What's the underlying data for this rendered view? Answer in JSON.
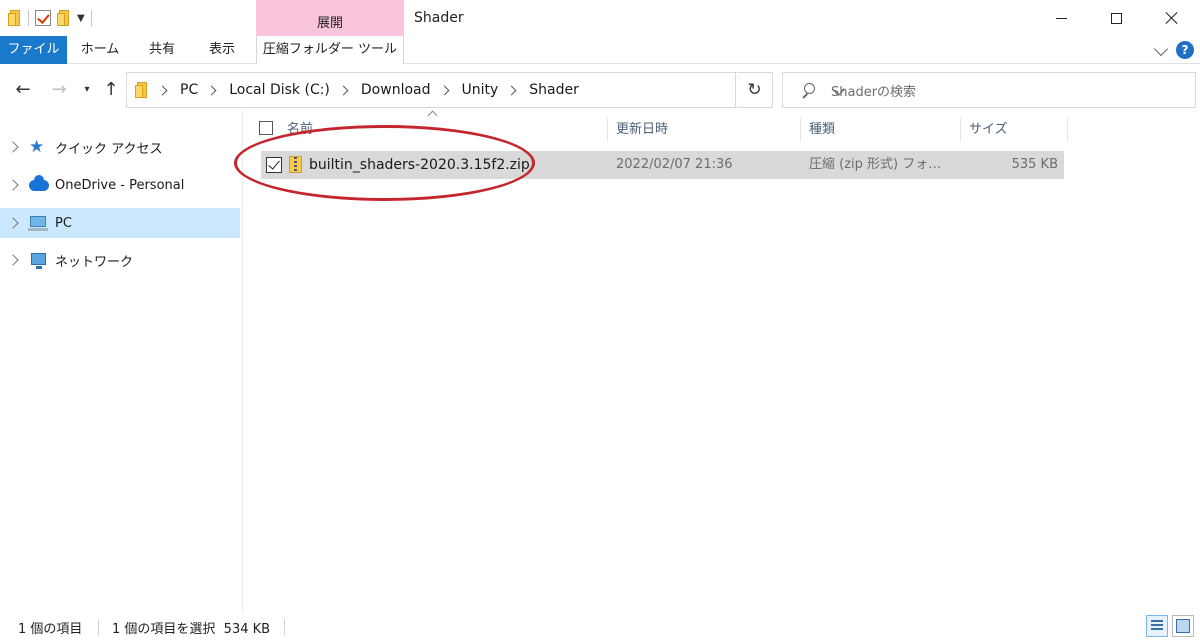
{
  "window": {
    "title": "Shader",
    "context_group_label": "展開"
  },
  "ribbon": {
    "tabs": [
      "ファイル",
      "ホーム",
      "共有",
      "表示",
      "圧縮フォルダー ツール"
    ]
  },
  "address_bar": {
    "breadcrumbs": [
      "PC",
      "Local Disk (C:)",
      "Download",
      "Unity",
      "Shader"
    ]
  },
  "search": {
    "placeholder": "Shaderの検索"
  },
  "sidebar": {
    "items": [
      {
        "label": "クイック アクセス",
        "icon": "star-icon",
        "selected": false
      },
      {
        "label": "OneDrive - Personal",
        "icon": "cloud-icon",
        "selected": false
      },
      {
        "label": "PC",
        "icon": "computer-icon",
        "selected": true
      },
      {
        "label": "ネットワーク",
        "icon": "network-icon",
        "selected": false
      }
    ]
  },
  "columns": {
    "name": "名前",
    "date": "更新日時",
    "type": "種類",
    "size": "サイズ"
  },
  "files": [
    {
      "name": "builtin_shaders-2020.3.15f2.zip",
      "date": "2022/02/07 21:36",
      "type": "圧縮 (zip 形式) フォル...",
      "size": "535 KB",
      "checked": true,
      "selected": true,
      "icon": "zip-folder-icon"
    }
  ],
  "status": {
    "item_count": "1 個の項目",
    "selection": "1 個の項目を選択  534 KB"
  },
  "colors": {
    "file_tab": "#1979ca",
    "context_tab": "#f8c5dc",
    "selected_nav": "#cce8ff",
    "selected_row": "#d9d9d9",
    "annotation": "#c4262e"
  }
}
